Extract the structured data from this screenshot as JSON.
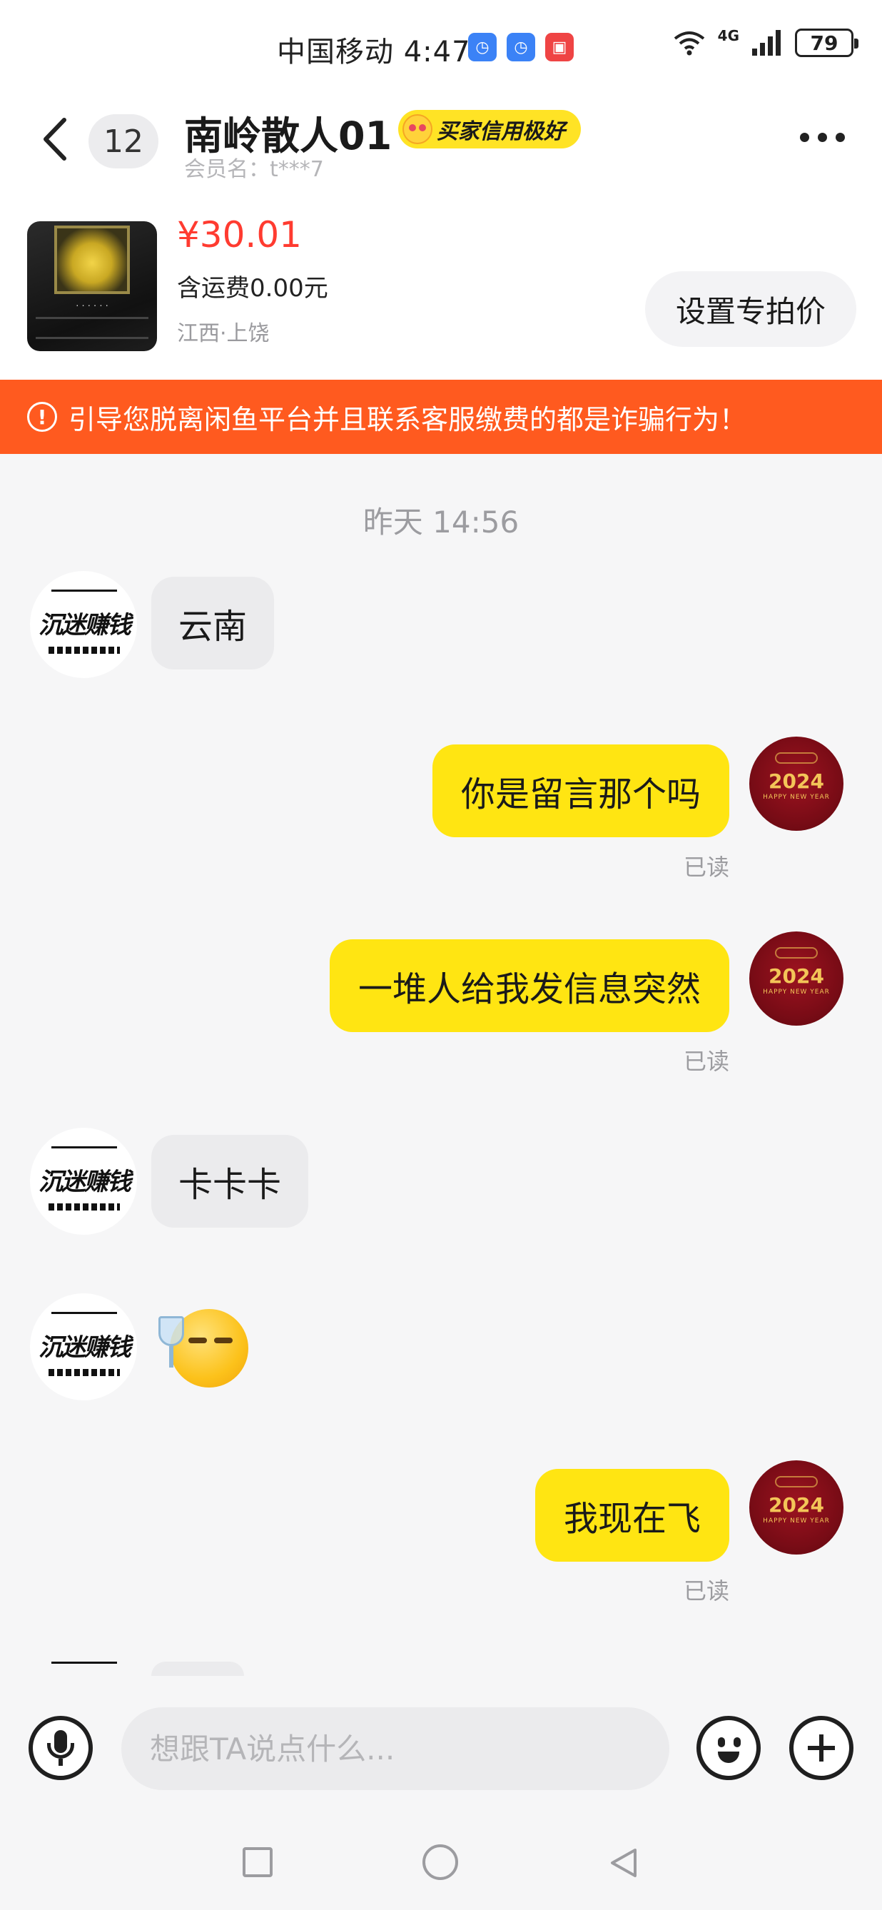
{
  "status_bar": {
    "carrier_time": "中国移动 4:47",
    "network": "4G",
    "battery": "79",
    "app_icons": [
      "alarm-app-icon",
      "alarm-app-icon",
      "huawei-app-icon"
    ]
  },
  "header": {
    "unread_count": "12",
    "title": "南岭散人01",
    "credit_badge": "买家信用极好",
    "member_name": "会员名：t***7"
  },
  "product": {
    "price": "¥30.01",
    "shipping": "含运费0.00元",
    "location": "江西·上饶",
    "set_price_button": "设置专拍价"
  },
  "warning": {
    "text": "引导您脱离闲鱼平台并且联系客服缴费的都是诈骗行为！"
  },
  "chat": {
    "timestamp": "昨天 14:56",
    "left_avatar_text": "沉迷赚钱",
    "right_avatar_text": "2024",
    "right_avatar_sub": "HAPPY NEW YEAR",
    "messages": [
      {
        "side": "left",
        "text": "云南"
      },
      {
        "side": "right",
        "text": "你是留言那个吗",
        "status": "已读"
      },
      {
        "side": "right",
        "text": "一堆人给我发信息突然",
        "status": "已读"
      },
      {
        "side": "left",
        "text": "卡卡卡"
      },
      {
        "side": "left",
        "sticker": "toasting-emoji"
      },
      {
        "side": "right",
        "text": "我现在飞",
        "status": "已读"
      }
    ]
  },
  "input_bar": {
    "placeholder": "想跟TA说点什么..."
  },
  "colors": {
    "accent_yellow": "#ffe512",
    "warning_orange": "#ff5a1f",
    "price_red": "#ff3b30"
  }
}
